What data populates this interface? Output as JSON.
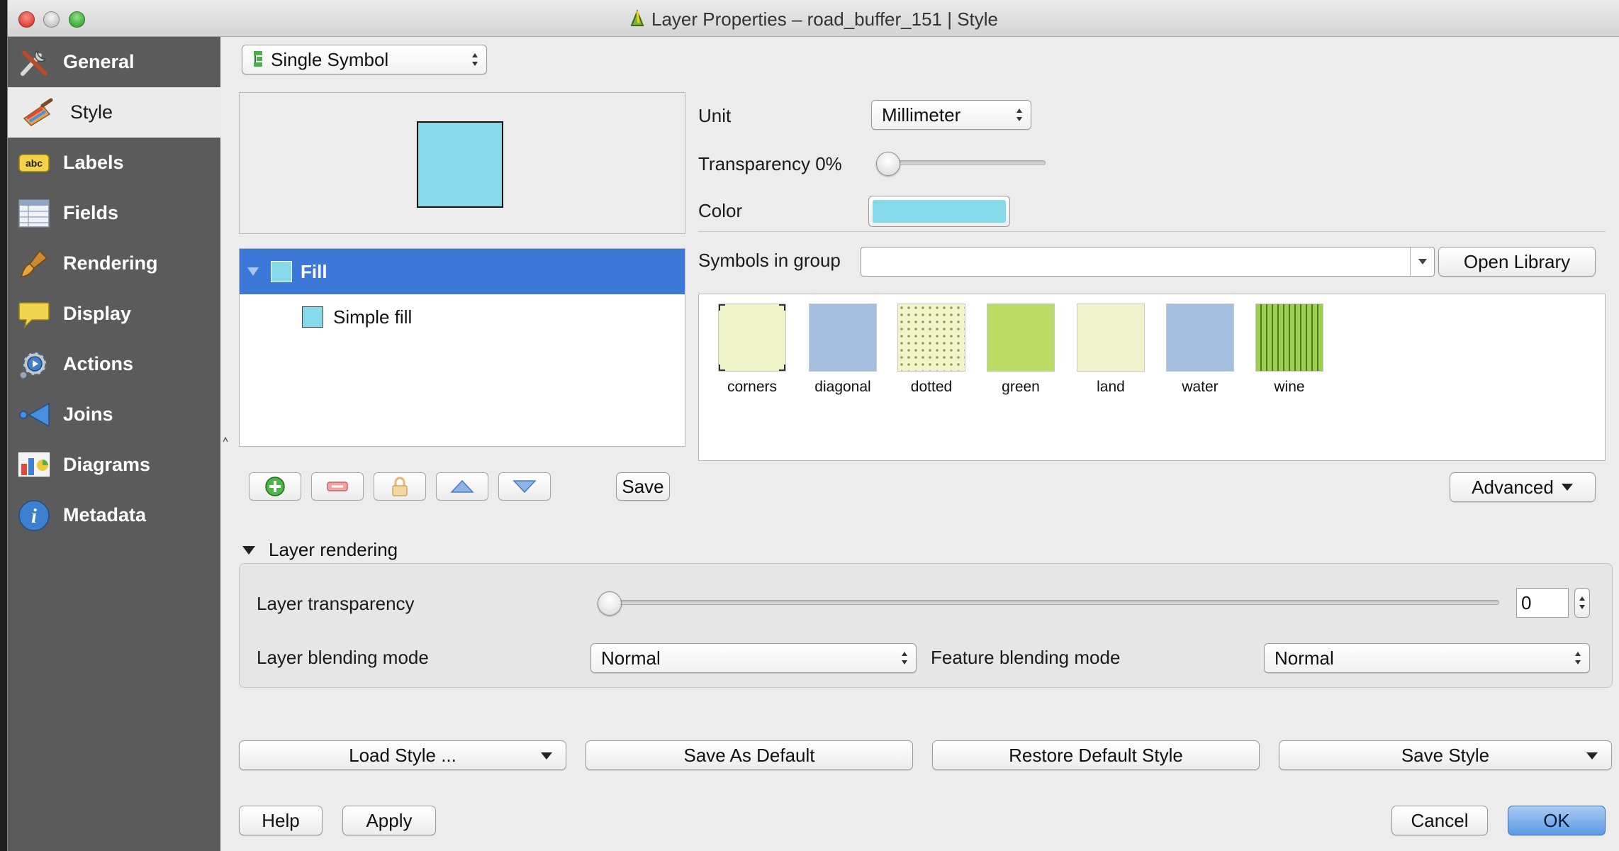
{
  "window": {
    "title": "Layer Properties – road_buffer_151 | Style"
  },
  "sidebar": {
    "items": [
      {
        "label": "General",
        "icon": "tools-icon"
      },
      {
        "label": "Style",
        "icon": "paintbrush-icon",
        "active": true
      },
      {
        "label": "Labels",
        "icon": "abc-icon"
      },
      {
        "label": "Fields",
        "icon": "table-icon"
      },
      {
        "label": "Rendering",
        "icon": "brush-icon"
      },
      {
        "label": "Display",
        "icon": "speech-bubble-icon"
      },
      {
        "label": "Actions",
        "icon": "gear-icon"
      },
      {
        "label": "Joins",
        "icon": "join-arrow-icon"
      },
      {
        "label": "Diagrams",
        "icon": "chart-icon"
      },
      {
        "label": "Metadata",
        "icon": "info-icon"
      }
    ]
  },
  "renderer": {
    "selected": "Single Symbol"
  },
  "symbol_tree": {
    "root": "Fill",
    "child": "Simple fill",
    "save_label": "Save"
  },
  "props": {
    "unit_label": "Unit",
    "unit_value": "Millimeter",
    "transparency_label": "Transparency 0%",
    "transparency_value": 0,
    "color_label": "Color",
    "color_value": "#86d9e8"
  },
  "symbols": {
    "group_label": "Symbols in group",
    "group_value": "",
    "open_library_label": "Open Library",
    "items": [
      {
        "name": "corners",
        "color": "#eff3c8"
      },
      {
        "name": "diagonal",
        "color": "#a4bedf"
      },
      {
        "name": "dotted",
        "color": "#f1f3c8"
      },
      {
        "name": "green",
        "color": "#b9dc64"
      },
      {
        "name": "land",
        "color": "#f0f3cc"
      },
      {
        "name": "water",
        "color": "#a4bedf"
      },
      {
        "name": "wine",
        "color": "#9ece50"
      }
    ],
    "advanced_label": "Advanced"
  },
  "layer_rendering": {
    "title": "Layer rendering",
    "transparency_label": "Layer transparency",
    "transparency_value": "0",
    "blend_label": "Layer blending mode",
    "blend_value": "Normal",
    "feature_blend_label": "Feature blending mode",
    "feature_blend_value": "Normal"
  },
  "style_buttons": {
    "load": "Load Style ...",
    "save_default": "Save As Default",
    "restore": "Restore Default Style",
    "save_style": "Save Style"
  },
  "dialog_buttons": {
    "help": "Help",
    "apply": "Apply",
    "cancel": "Cancel",
    "ok": "OK"
  },
  "colors": {
    "accent": "#3b78d8",
    "sidebar": "#5b5b5b",
    "fill_color": "#86d9e8"
  }
}
